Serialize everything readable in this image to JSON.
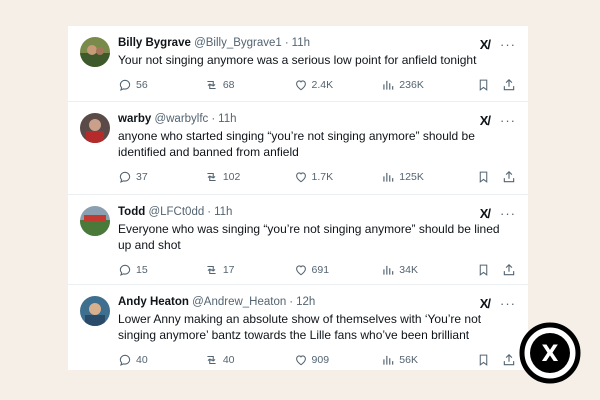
{
  "colors": {
    "background": "#f6efe8",
    "card": "#ffffff",
    "text": "#0f1419",
    "muted": "#536471"
  },
  "header_icons": {
    "grok": "grok-icon",
    "more": "more-options-icon"
  },
  "tweets": [
    {
      "name": "Billy Bygrave",
      "handle": "@Billy_Bygrave1",
      "time": "11h",
      "text": "Your not singing anymore was a serious low point for anfield tonight",
      "replies": "56",
      "retweets": "68",
      "likes": "2.4K",
      "views": "236K"
    },
    {
      "name": "warby",
      "handle": "@warbylfc",
      "time": "11h",
      "text": "anyone who started singing “you’re not singing anymore” should be identified and banned from anfield",
      "replies": "37",
      "retweets": "102",
      "likes": "1.7K",
      "views": "125K"
    },
    {
      "name": "Todd",
      "handle": "@LFCt0dd",
      "time": "11h",
      "text": "Everyone who was singing “you’re not singing anymore” should be lined up and shot",
      "replies": "15",
      "retweets": "17",
      "likes": "691",
      "views": "34K"
    },
    {
      "name": "Andy Heaton",
      "handle": "@Andrew_Heaton",
      "time": "12h",
      "text": "Lower Anny making an absolute show of themselves with  ‘You’re not singing anymore’ bantz towards the Lille fans who’ve been brilliant",
      "replies": "40",
      "retweets": "40",
      "likes": "909",
      "views": "56K"
    }
  ],
  "separator": "·",
  "grok_glyph": "X/",
  "more_glyph": "···",
  "logo_glyph": "X"
}
